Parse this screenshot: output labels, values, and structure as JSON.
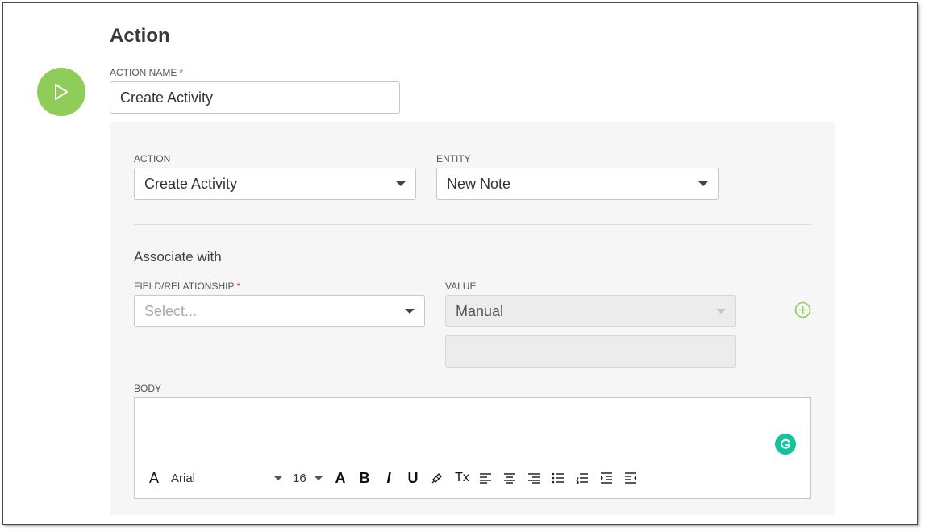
{
  "header": {
    "title": "Action"
  },
  "action_name": {
    "label": "ACTION NAME",
    "required_mark": "*",
    "value": "Create Activity"
  },
  "action": {
    "label": "ACTION",
    "value": "Create Activity"
  },
  "entity": {
    "label": "ENTITY",
    "value": "New Note"
  },
  "associate": {
    "title": "Associate with",
    "field_label": "FIELD/RELATIONSHIP",
    "required_mark": "*",
    "field_placeholder": "Select...",
    "value_label": "VALUE",
    "value_selected": "Manual",
    "manual_value": ""
  },
  "body": {
    "label": "BODY",
    "content": "",
    "toolbar": {
      "font": "Arial",
      "size": "16",
      "bold": "B",
      "italic": "I",
      "underline": "U",
      "clear": "Tx",
      "font_color": "A"
    }
  },
  "colors": {
    "accent_green": "#8fcc5a",
    "grammarly": "#15c39a"
  }
}
